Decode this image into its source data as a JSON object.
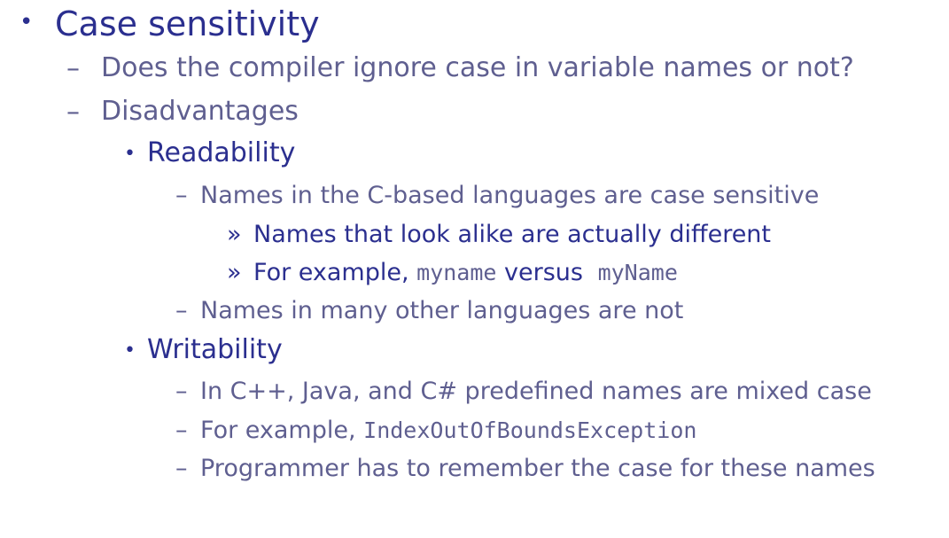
{
  "slide": {
    "bullet_l1": "•",
    "bullet_l2": "–",
    "bullet_l3": "•",
    "bullet_l4": "–",
    "bullet_l5": "»",
    "title": "Case sensitivity",
    "q1": "Does the compiler ignore case in variable names or not?",
    "disadvantages": "Disadvantages",
    "readability": "Readability",
    "r1": "Names in the C-based languages are case sensitive",
    "r1a": "Names that look alike are actually different",
    "r1b_prefix": "For example, ",
    "r1b_code1": "myname",
    "r1b_mid": " versus ",
    "r1b_code2": "myName",
    "r2": "Names in many other languages are not",
    "writability": "Writability",
    "w1": "In C++, Java, and C# predefined names are mixed case",
    "w2_prefix": "For example, ",
    "w2_code": "IndexOutOfBoundsException",
    "w3": "Programmer has to remember the case for these names"
  }
}
